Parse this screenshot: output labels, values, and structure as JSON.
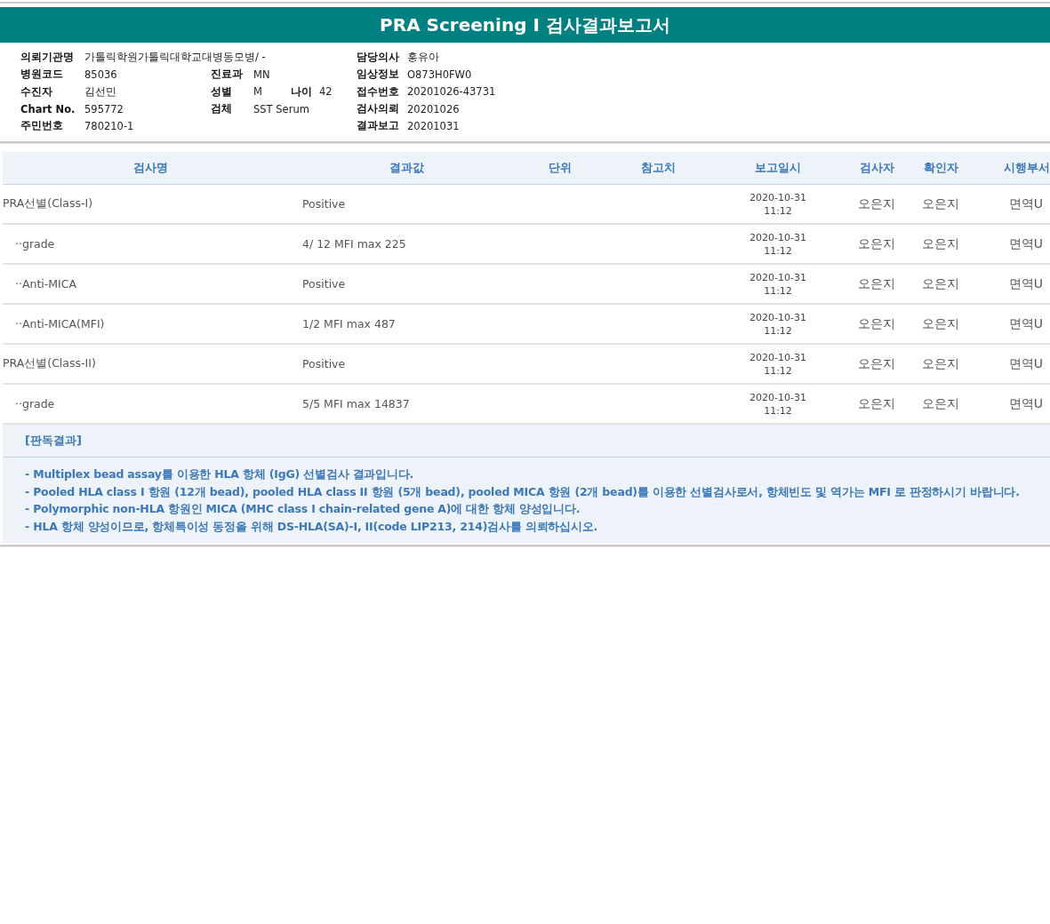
{
  "title": "PRA Screening I 검사결과보고서",
  "info": {
    "rows": [
      {
        "left": [
          {
            "label": "의뢰기관명",
            "value": "가톨릭학원가톨릭대학교대병동모병/ -"
          }
        ],
        "middle": [],
        "right": [
          {
            "label": "담당의사",
            "value": "홍유아"
          }
        ]
      },
      {
        "left": [
          {
            "label": "병원코드",
            "value": "85036"
          }
        ],
        "middle": [
          {
            "label": "진료과",
            "value": "MN"
          }
        ],
        "right": [
          {
            "label": "임상정보",
            "value": "O873H0FW0"
          }
        ]
      },
      {
        "left": [
          {
            "label": "수진자",
            "value": "김선민"
          }
        ],
        "middle": [
          {
            "label": "성별",
            "value": "M"
          },
          {
            "label": "나이",
            "value": "42"
          }
        ],
        "right": [
          {
            "label": "접수번호",
            "value": "20201026-43731"
          }
        ]
      },
      {
        "left": [
          {
            "label": "Chart No.",
            "value": "595772"
          }
        ],
        "middle": [
          {
            "label": "검체",
            "value": "SST Serum"
          }
        ],
        "right": [
          {
            "label": "검사의뢰",
            "value": "20201026"
          }
        ]
      },
      {
        "left": [
          {
            "label": "주민번호",
            "value": "780210-1"
          }
        ],
        "middle": [],
        "right": [
          {
            "label": "결과보고",
            "value": "20201031"
          }
        ]
      }
    ]
  },
  "table": {
    "columns": [
      "검사명",
      "결과값",
      "단위",
      "참고치",
      "보고일시",
      "검사자",
      "확인자",
      "시행부서"
    ],
    "rows": [
      {
        "name": "PRA선별(Class-I)",
        "result": "Positive",
        "date": "2020-10-31",
        "time": "11:12",
        "tester": "오은지",
        "confirmer": "오은지",
        "dept": "면역U",
        "children": [
          {
            "name": "··grade",
            "result": "4/ 12 MFI max 225",
            "date": "2020-10-31",
            "time": "11:12",
            "tester": "오은지",
            "confirmer": "오은지",
            "dept": "면역U"
          },
          {
            "name": "··Anti-MICA",
            "result": "Positive",
            "date": "2020-10-31",
            "time": "11:12",
            "tester": "오은지",
            "confirmer": "오은지",
            "dept": "면역U"
          },
          {
            "name": "··Anti-MICA(MFI)",
            "result": "1/2 MFI max 487",
            "date": "2020-10-31",
            "time": "11:12",
            "tester": "오은지",
            "confirmer": "오은지",
            "dept": "면역U"
          }
        ]
      },
      {
        "name": "PRA선별(Class-II)",
        "result": "Positive",
        "date": "2020-10-31",
        "time": "11:12",
        "tester": "오은지",
        "confirmer": "오은지",
        "dept": "면역U",
        "children": [
          {
            "name": "··grade",
            "result": "5/5 MFI max 14837",
            "date": "2020-10-31",
            "time": "11:12",
            "tester": "오은지",
            "confirmer": "오은지",
            "dept": "면역U"
          }
        ]
      }
    ]
  },
  "interpretation": {
    "heading": "[판독결과]",
    "lines": [
      "- Multiplex bead assay를 이용한 HLA 항체 (IgG) 선별검사 결과입니다.",
      "- Pooled HLA class I 항원 (12개 bead), pooled HLA class II 항원 (5개 bead), pooled MICA 항원 (2개 bead)를 이용한 선별검사로서, 항체빈도 및 역가는 MFI 로 판정하시기 바랍니다.",
      "- Polymorphic non-HLA 항원인 MICA (MHC class I chain-related gene A)에 대한 항체 양성입니다.",
      "- HLA 항체 양성이므로, 항체특이성 동정을 위해 DS-HLA(SA)-I, II(code LIP213, 214)검사를 의뢰하십시오."
    ]
  }
}
